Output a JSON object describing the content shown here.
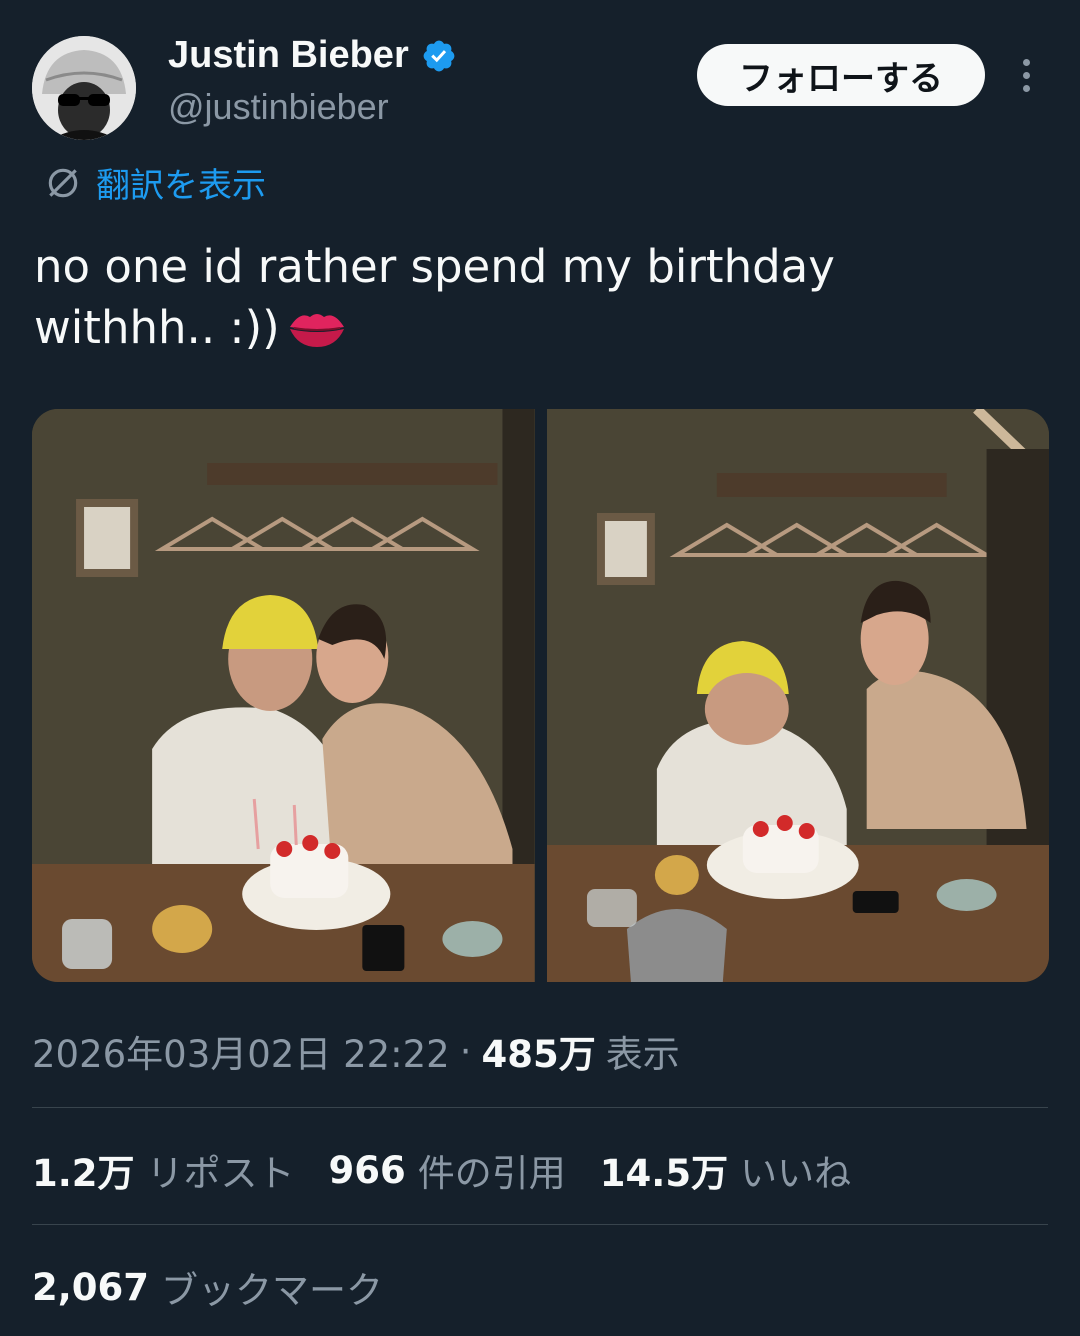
{
  "author": {
    "display_name": "Justin Bieber",
    "handle": "@justinbieber",
    "verified": true
  },
  "actions": {
    "follow_label": "フォローする"
  },
  "translate": {
    "label": "翻訳を表示"
  },
  "tweet": {
    "text_line1": "no one id rather spend my birthday",
    "text_line2": "withhh.. :))"
  },
  "meta": {
    "timestamp": "2026年03月02日 22:22",
    "separator": "·",
    "views_count": "485万",
    "views_label": "表示"
  },
  "stats": {
    "reposts_count": "1.2万",
    "reposts_label": "リポスト",
    "quotes_count": "966",
    "quotes_label": "件の引用",
    "likes_count": "14.5万",
    "likes_label": "いいね",
    "bookmarks_count": "2,067",
    "bookmarks_label": "ブックマーク"
  },
  "colors": {
    "background": "#15202b",
    "link": "#1d9bf0",
    "secondary_text": "#8b98a5",
    "divider": "#38444d"
  }
}
